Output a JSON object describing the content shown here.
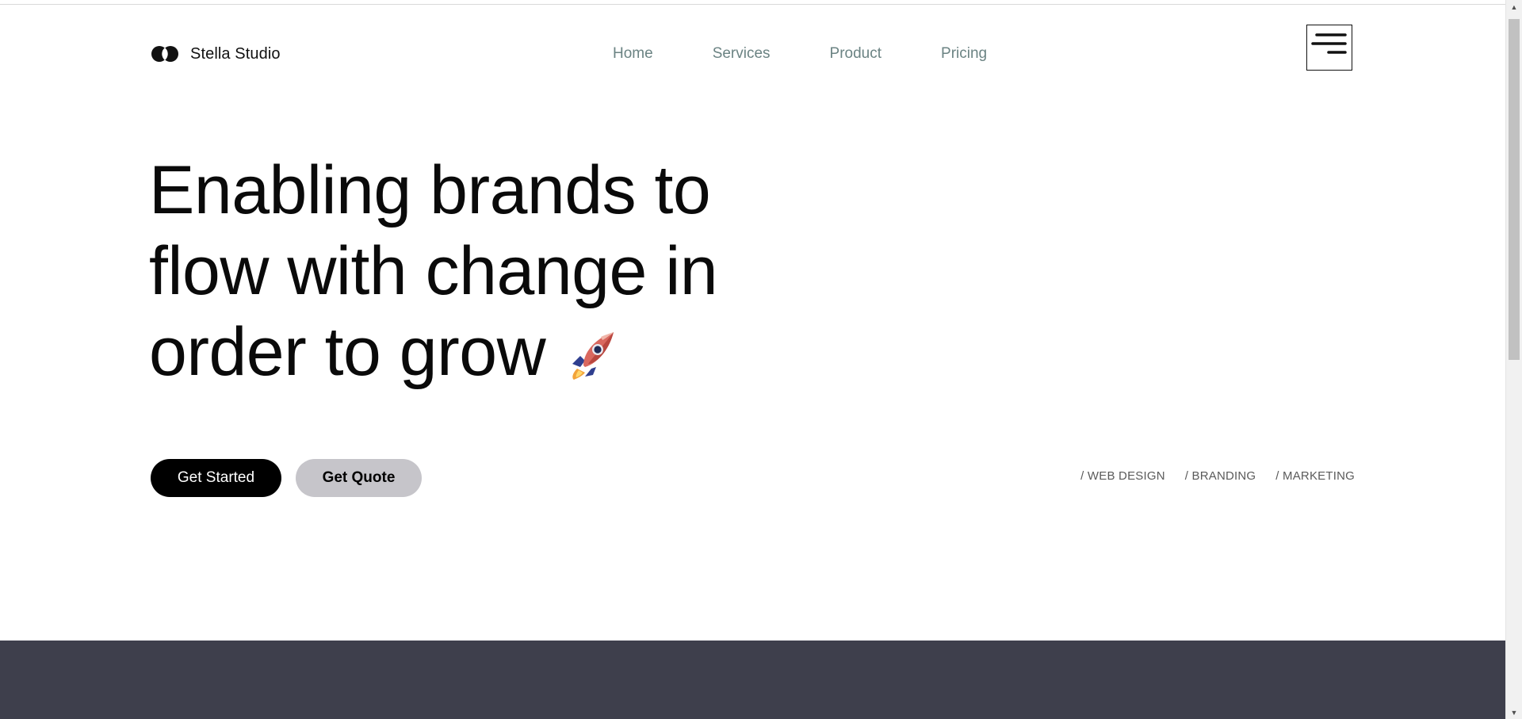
{
  "brand": {
    "name": "Stella Studio",
    "logo_icon": "overlapping-circles-logo"
  },
  "nav": {
    "items": [
      {
        "label": "Home"
      },
      {
        "label": "Services"
      },
      {
        "label": "Product"
      },
      {
        "label": "Pricing"
      }
    ],
    "link_color": "#6b8383"
  },
  "menu": {
    "icon": "hamburger-menu-icon"
  },
  "hero": {
    "title_lines": [
      "Enabling brands to",
      "flow with change in",
      "order to grow"
    ],
    "title_icon": "rocket-icon"
  },
  "cta": {
    "primary_label": "Get Started",
    "secondary_label": "Get Quote",
    "primary_color": "#000000",
    "secondary_color": "#c6c5ca"
  },
  "tags": [
    "/ WEB DESIGN",
    "/ BRANDING",
    "/ MARKETING"
  ],
  "colors": {
    "dark_band": "#3e3f4c",
    "text": "#0a0a0a"
  }
}
